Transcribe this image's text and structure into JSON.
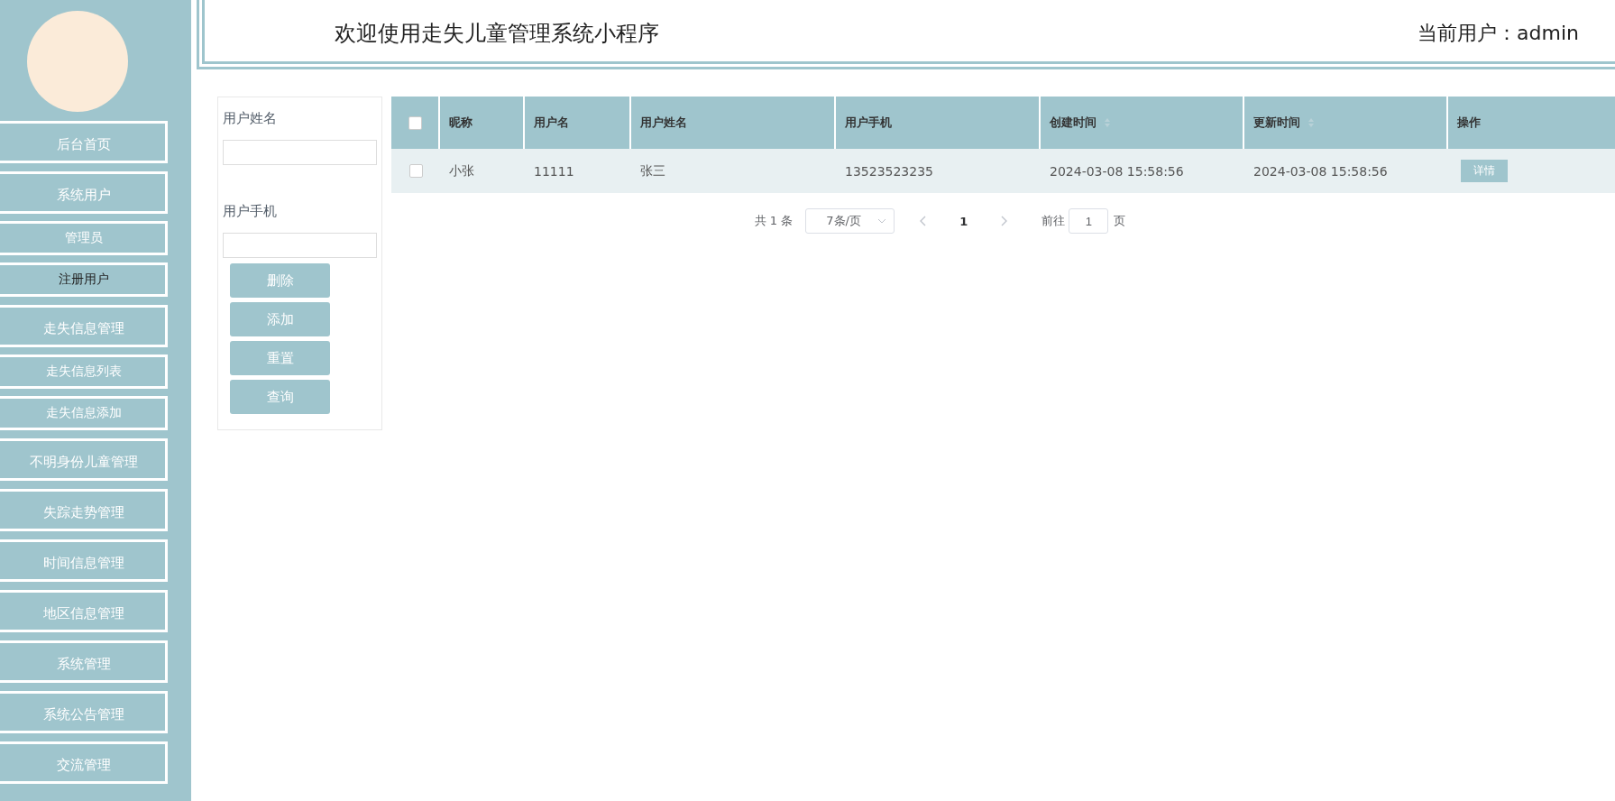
{
  "sidebar": {
    "items": [
      {
        "label": "后台首页",
        "kind": "main",
        "selected": false
      },
      {
        "label": "系统用户",
        "kind": "main",
        "selected": false
      },
      {
        "label": "管理员",
        "kind": "sub",
        "selected": false
      },
      {
        "label": "注册用户",
        "kind": "sub",
        "selected": true
      },
      {
        "label": "走失信息管理",
        "kind": "main",
        "selected": false
      },
      {
        "label": "走失信息列表",
        "kind": "sub",
        "selected": false
      },
      {
        "label": "走失信息添加",
        "kind": "sub",
        "selected": false
      },
      {
        "label": "不明身份儿童管理",
        "kind": "main",
        "selected": false
      },
      {
        "label": "失踪走势管理",
        "kind": "main",
        "selected": false
      },
      {
        "label": "时间信息管理",
        "kind": "main",
        "selected": false
      },
      {
        "label": "地区信息管理",
        "kind": "main",
        "selected": false
      },
      {
        "label": "系统管理",
        "kind": "main",
        "selected": false
      },
      {
        "label": "系统公告管理",
        "kind": "main",
        "selected": false
      },
      {
        "label": "交流管理",
        "kind": "main",
        "selected": false
      }
    ]
  },
  "header": {
    "title": "欢迎使用走失儿童管理系统小程序",
    "user": "当前用户：admin"
  },
  "filters": [
    {
      "label": "用户姓名"
    },
    {
      "label": "用户手机"
    }
  ],
  "buttons": [
    "删除",
    "添加",
    "重置",
    "查询"
  ],
  "table": {
    "select_all": {
      "checked": false
    },
    "columns": [
      {
        "label": "昵称",
        "sortable": false
      },
      {
        "label": "用户名",
        "sortable": false
      },
      {
        "label": "用户姓名",
        "sortable": false
      },
      {
        "label": "用户手机",
        "sortable": false
      },
      {
        "label": "创建时间",
        "sortable": true
      },
      {
        "label": "更新时间",
        "sortable": true
      },
      {
        "label": "操作",
        "sortable": false
      }
    ],
    "rows": [
      {
        "selected": false,
        "cells": [
          "小张",
          "11111",
          "张三",
          "13523523235",
          "2024-03-08 15:58:56",
          "2024-03-08 15:58:56"
        ],
        "action": "详情"
      }
    ]
  },
  "pagination": {
    "total": "共 1 条",
    "page_size": "7条/页",
    "prev_disabled": true,
    "current": "1",
    "next_disabled": true,
    "goto_label": "前往",
    "goto_value": "1",
    "goto_suffix": "页"
  }
}
